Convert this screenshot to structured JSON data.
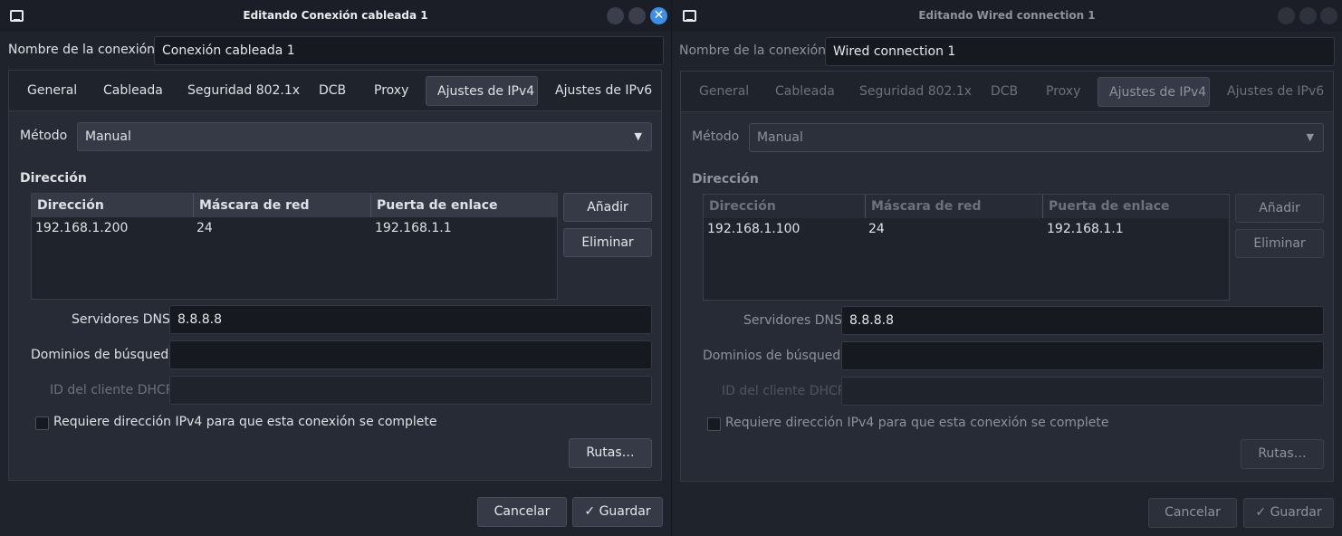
{
  "windows": [
    {
      "title": "Editando Conexión cableada 1",
      "connection_name_label": "Nombre de la conexión",
      "connection_name_value": "Conexión cableada 1",
      "tabs": [
        "General",
        "Cableada",
        "Seguridad 802.1x",
        "DCB",
        "Proxy",
        "Ajustes de IPv4",
        "Ajustes de IPv6"
      ],
      "active_tab": "Ajustes de IPv4",
      "method_label": "Método",
      "method_value": "Manual",
      "addresses_heading": "Dirección",
      "columns": [
        "Dirección",
        "Máscara de red",
        "Puerta de enlace"
      ],
      "rows": [
        [
          "192.168.1.200",
          "24",
          "192.168.1.1"
        ]
      ],
      "add_button": "Añadir",
      "delete_button": "Eliminar",
      "dns_label": "Servidores DNS",
      "dns_value": "8.8.8.8",
      "search_domains_label": "Dominios de búsqueda",
      "search_domains_value": "",
      "dhcp_client_id_label": "ID del cliente DHCP",
      "dhcp_client_id_value": "",
      "require_ipv4_label": "Requiere dirección IPv4 para que esta conexión se complete",
      "require_ipv4_checked": false,
      "routes_button": "Rutas…",
      "cancel_button": "Cancelar",
      "save_button": "Guardar",
      "active": true
    },
    {
      "title": "Editando Wired connection 1",
      "connection_name_label": "Nombre de la conexión",
      "connection_name_value": "Wired connection 1",
      "tabs": [
        "General",
        "Cableada",
        "Seguridad 802.1x",
        "DCB",
        "Proxy",
        "Ajustes de IPv4",
        "Ajustes de IPv6"
      ],
      "active_tab": "Ajustes de IPv4",
      "method_label": "Método",
      "method_value": "Manual",
      "addresses_heading": "Dirección",
      "columns": [
        "Dirección",
        "Máscara de red",
        "Puerta de enlace"
      ],
      "rows": [
        [
          "192.168.1.100",
          "24",
          "192.168.1.1"
        ]
      ],
      "add_button": "Añadir",
      "delete_button": "Eliminar",
      "dns_label": "Servidores DNS",
      "dns_value": "8.8.8.8",
      "search_domains_label": "Dominios de búsqueda",
      "search_domains_value": "",
      "dhcp_client_id_label": "ID del cliente DHCP",
      "dhcp_client_id_value": "",
      "require_ipv4_label": "Requiere dirección IPv4 para que esta conexión se complete",
      "require_ipv4_checked": false,
      "routes_button": "Rutas…",
      "cancel_button": "Cancelar",
      "save_button": "Guardar",
      "active": false
    }
  ],
  "icons": {
    "close": "close-icon",
    "checkmark": "✓",
    "dropdown_arrow": "▼"
  },
  "colors": {
    "accent": "#3d8ee8",
    "background": "#1f232c",
    "panel": "#272b35"
  }
}
